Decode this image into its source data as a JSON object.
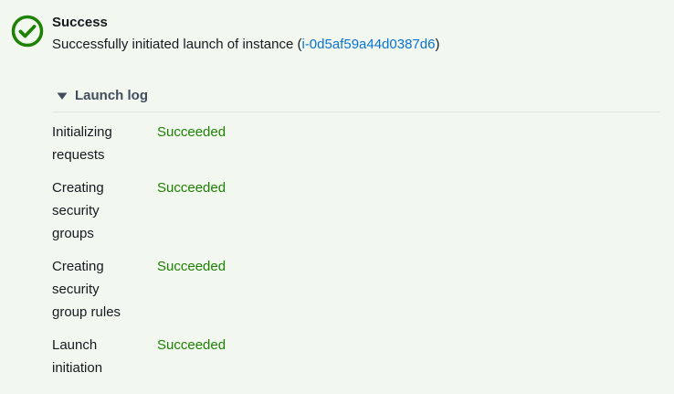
{
  "alert": {
    "type": "success",
    "title": "Success",
    "message_prefix": "Successfully initiated launch of instance (",
    "instance_id": "i-0d5af59a44d0387d6",
    "message_suffix": ")",
    "icon": "check-circle-icon",
    "success_color": "#1d8102",
    "link_color": "#0972d3"
  },
  "launch_log": {
    "title": "Launch log",
    "expanded": true,
    "rows": [
      {
        "step_lines": [
          "Initializing",
          "requests"
        ],
        "status": "Succeeded"
      },
      {
        "step_lines": [
          "Creating",
          "security",
          "groups"
        ],
        "status": "Succeeded"
      },
      {
        "step_lines": [
          "Creating",
          "security",
          "group rules"
        ],
        "status": "Succeeded"
      },
      {
        "step_lines": [
          "Launch",
          "initiation"
        ],
        "status": "Succeeded"
      }
    ]
  }
}
